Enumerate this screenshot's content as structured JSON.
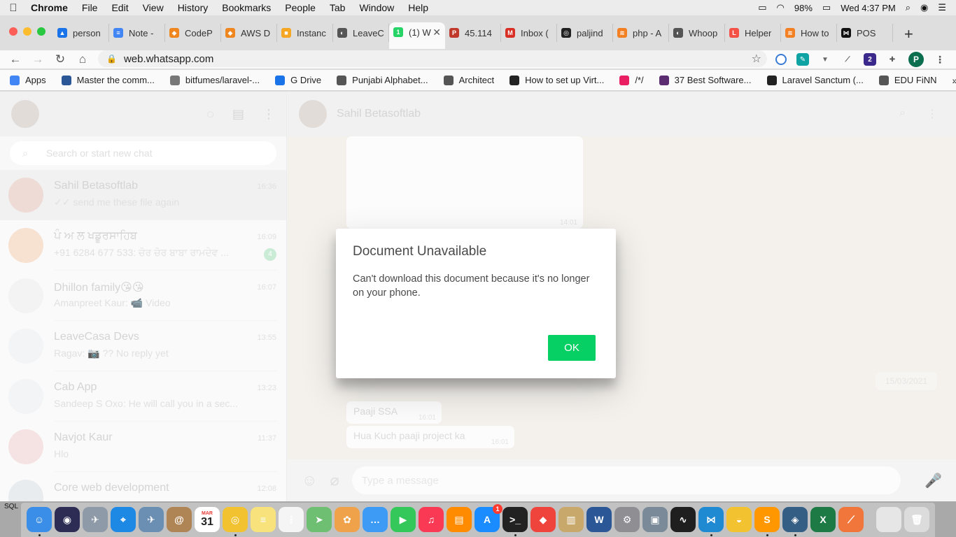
{
  "menubar": {
    "app": "Chrome",
    "items": [
      "File",
      "Edit",
      "View",
      "History",
      "Bookmarks",
      "People",
      "Tab",
      "Window",
      "Help"
    ],
    "battery": "98%",
    "clock": "Wed 4:37 PM"
  },
  "tabs": [
    {
      "label": "person",
      "color": "#1a73e8",
      "glyph": "▲"
    },
    {
      "label": "Note -",
      "color": "#4285f4",
      "glyph": "≡"
    },
    {
      "label": "CodeP",
      "color": "#f0861f",
      "glyph": "◆"
    },
    {
      "label": "AWS D",
      "color": "#f0861f",
      "glyph": "◆"
    },
    {
      "label": "Instanc",
      "color": "#f5a623",
      "glyph": "■"
    },
    {
      "label": "LeaveC",
      "color": "#555555",
      "glyph": "◐"
    },
    {
      "label": "(1) W",
      "color": "#25d366",
      "glyph": "1"
    },
    {
      "label": "45.114",
      "color": "#c0392b",
      "glyph": "P"
    },
    {
      "label": "Inbox (",
      "color": "#d93025",
      "glyph": "M"
    },
    {
      "label": "paljind",
      "color": "#222222",
      "glyph": "◎"
    },
    {
      "label": "php - A",
      "color": "#f48024",
      "glyph": "≋"
    },
    {
      "label": "Whoop",
      "color": "#555555",
      "glyph": "◐"
    },
    {
      "label": "Helper",
      "color": "#f55247",
      "glyph": "L"
    },
    {
      "label": "How to",
      "color": "#f48024",
      "glyph": "≋"
    },
    {
      "label": "POS",
      "color": "#111111",
      "glyph": "⋈"
    }
  ],
  "address": {
    "url": "web.whatsapp.com"
  },
  "bookmarks": [
    {
      "label": "Apps",
      "color": "#4285f4"
    },
    {
      "label": "Master the comm...",
      "color": "#2b5797"
    },
    {
      "label": "bitfumes/laravel-...",
      "color": "#777777"
    },
    {
      "label": "G Drive",
      "color": "#1a73e8"
    },
    {
      "label": "Punjabi Alphabet...",
      "color": "#555555"
    },
    {
      "label": "Architect",
      "color": "#555555"
    },
    {
      "label": "How to set up Virt...",
      "color": "#222222"
    },
    {
      "label": "/*/",
      "color": "#e91e63"
    },
    {
      "label": "37 Best Software...",
      "color": "#5b2c6f"
    },
    {
      "label": "Laravel Sanctum (...",
      "color": "#222222"
    },
    {
      "label": "EDU FiNN",
      "color": "#555555"
    }
  ],
  "whatsapp": {
    "search_placeholder": "Search or start new chat",
    "chats": [
      {
        "name": "Sahil Betasoftlab",
        "time": "16:36",
        "message": "✓✓ send me these file again",
        "badge": ""
      },
      {
        "name": "ਪੰ ਅ ਲ ਖਡੂਰਸਾਹਿਬ",
        "time": "16:09",
        "message": "+91 6284 677 533: ਚੋਰ ਚੋਰ ਬਾਬਾ ਰਾਮਦੇਵ ...",
        "badge": "4"
      },
      {
        "name": "Dhillon family😘😘",
        "time": "16:07",
        "message": "Amanpreet Kaur: 📹 Video",
        "badge": ""
      },
      {
        "name": "LeaveCasa Devs",
        "time": "13:55",
        "message": "Ragav: 📷 ?? No reply yet",
        "badge": ""
      },
      {
        "name": "Cab App",
        "time": "13:23",
        "message": "Sandeep S Oxo: He will call you in a sec...",
        "badge": ""
      },
      {
        "name": "Navjot Kaur",
        "time": "11:37",
        "message": "Hlo",
        "badge": ""
      },
      {
        "name": "Core web development",
        "time": "12:08",
        "message": "",
        "badge": ""
      }
    ],
    "contact_name": "Sahil Betasoftlab",
    "image_time": "14:01",
    "date_pill": "15/03/2021",
    "messages": [
      {
        "text": "Paaji SSA",
        "time": "16:01"
      },
      {
        "text": "Hua Kuch paaji project ka",
        "time": "16:01"
      }
    ],
    "composer_placeholder": "Type a message"
  },
  "modal": {
    "title": "Document Unavailable",
    "body": "Can't download this document because it's no longer on your phone.",
    "ok_label": "OK",
    "accent": "#06cf64"
  },
  "dock": {
    "left_label": "SQL",
    "calendar_day": "31",
    "calendar_month": "MAR",
    "appstore_badge": "1"
  }
}
